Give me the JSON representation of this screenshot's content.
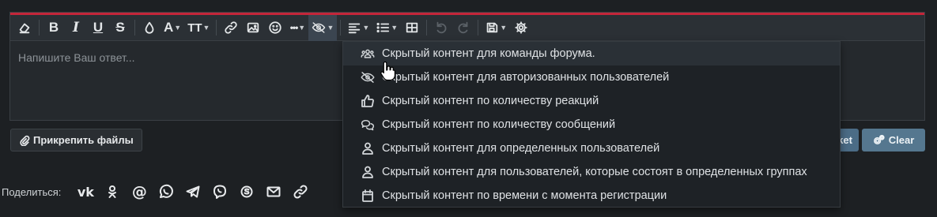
{
  "editor": {
    "placeholder": "Напишите Ваш ответ...",
    "toolbar": [
      {
        "name": "remove-format-icon"
      },
      {
        "name": "bold-icon",
        "glyph": "B"
      },
      {
        "name": "italic-icon",
        "glyph": "I"
      },
      {
        "name": "underline-icon",
        "glyph": "U"
      },
      {
        "name": "strikethrough-icon",
        "glyph": "S"
      },
      {
        "name": "text-color-icon"
      },
      {
        "name": "font-family-icon",
        "glyph": "A"
      },
      {
        "name": "font-size-icon",
        "glyph": "TT"
      },
      {
        "name": "link-icon"
      },
      {
        "name": "image-icon"
      },
      {
        "name": "emoji-icon"
      },
      {
        "name": "more-icon",
        "glyph": "•••"
      },
      {
        "name": "hide-content-icon",
        "active": true
      },
      {
        "name": "align-icon"
      },
      {
        "name": "list-icon"
      },
      {
        "name": "table-icon"
      },
      {
        "name": "undo-icon",
        "disabled": true
      },
      {
        "name": "redo-icon",
        "disabled": true
      },
      {
        "name": "drafts-icon"
      },
      {
        "name": "settings-icon"
      }
    ]
  },
  "actions": {
    "attach_label": "Прикрепить файлы",
    "ticket_label": "ket",
    "clear_label": "Clear"
  },
  "share": {
    "label": "Поделиться:",
    "icons": [
      "vk-icon",
      "odnoklassniki-icon",
      "email-at-icon",
      "whatsapp-icon",
      "telegram-icon",
      "viber-icon",
      "skype-icon",
      "mail-icon",
      "link-icon"
    ]
  },
  "hide_menu": {
    "items": [
      {
        "icon": "users-icon",
        "label": "Скрытый контент для команды форума."
      },
      {
        "icon": "eye-slash-icon",
        "label": "Скрытый контент для авторизованных пользователей"
      },
      {
        "icon": "thumbs-up-icon",
        "label": "Скрытый контент по количеству реакций"
      },
      {
        "icon": "comments-icon",
        "label": "Скрытый контент по количеству сообщений"
      },
      {
        "icon": "user-icon",
        "label": "Скрытый контент для определенных пользователей"
      },
      {
        "icon": "user-icon",
        "label": "Скрытый контент для пользователей, которые состоят в определенных группах"
      },
      {
        "icon": "calendar-icon",
        "label": "Скрытый контент по времени с момента регистрации"
      }
    ]
  },
  "colors": {
    "accent_line": "#c4263a",
    "clear_button": "#55778f",
    "background": "#1d2023"
  }
}
